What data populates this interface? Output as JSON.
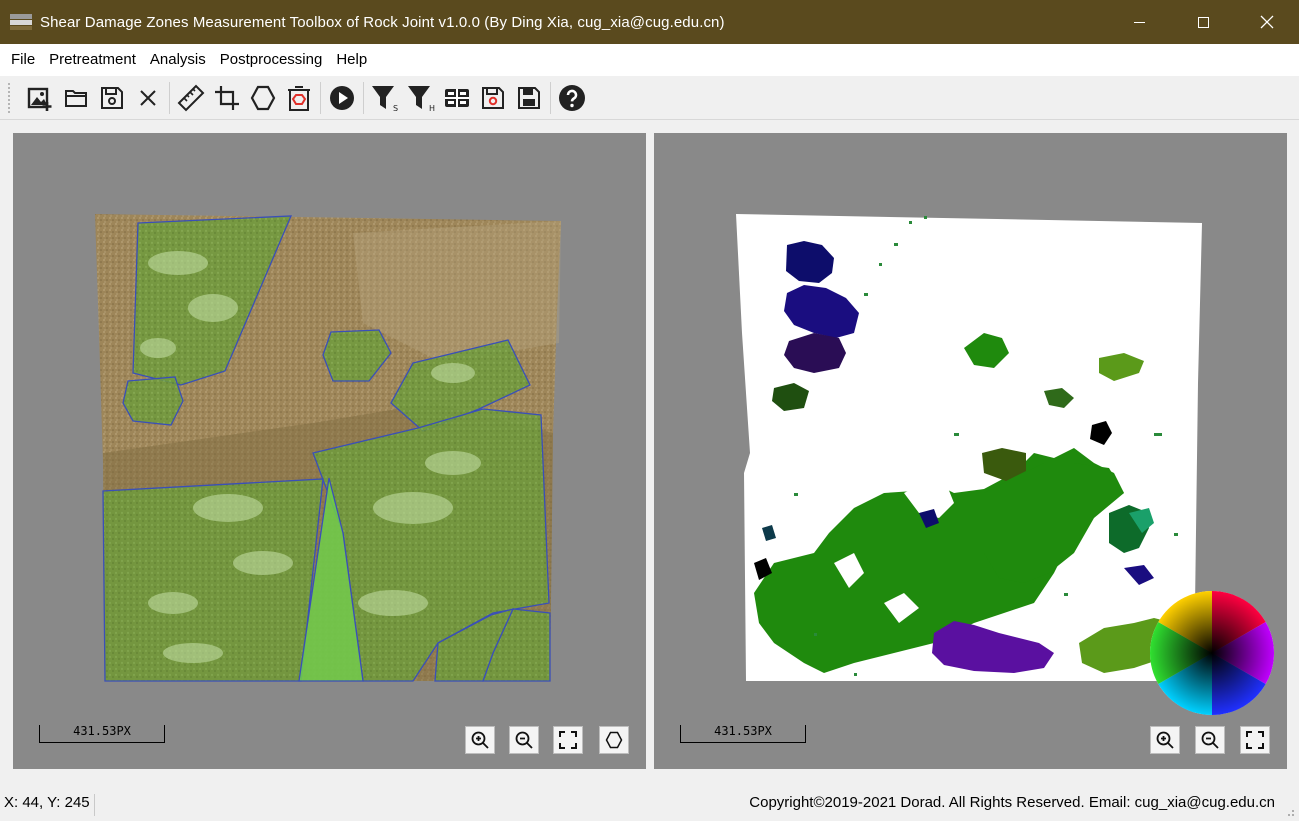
{
  "window": {
    "title": "Shear Damage Zones Measurement Toolbox of Rock Joint v1.0.0 (By Ding Xia, cug_xia@cug.edu.cn)",
    "controls": [
      "minimize-icon",
      "maximize-icon",
      "close-icon"
    ]
  },
  "menu": [
    "File",
    "Pretreatment",
    "Analysis",
    "Postprocessing",
    "Help"
  ],
  "toolbar": {
    "icons": [
      "open-image-icon",
      "open-folder-icon",
      "save-icon",
      "close-icon",
      "ruler-icon",
      "crop-icon",
      "polygon-icon",
      "delete-polygon-icon",
      "run-icon",
      "filter-s-icon",
      "filter-h-icon",
      "grid-table-icon",
      "save-result-icon",
      "save-all-icon",
      "help-icon"
    ]
  },
  "left_panel": {
    "scale_label": "431.53PX",
    "buttons": [
      "zoom-in-icon",
      "zoom-out-icon",
      "fit-view-icon",
      "polygon-icon"
    ]
  },
  "right_panel": {
    "scale_label": "431.53PX",
    "buttons": [
      "zoom-in-icon",
      "zoom-out-icon",
      "fit-view-icon"
    ],
    "legend": "color-wheel"
  },
  "status": {
    "coords": "X: 44, Y: 245",
    "copyright": "Copyright©2019-2021 Dorad. All Rights Reserved. Email: cug_xia@cug.edu.cn"
  },
  "colors": {
    "titlebar": "#5a4a1e",
    "panel_bg": "#898989",
    "rock": "#a48b5c",
    "damage_overlay": "#6fbd45",
    "polygon_outline": "#3a4fb8",
    "zone_main": "#1f8a0d"
  }
}
